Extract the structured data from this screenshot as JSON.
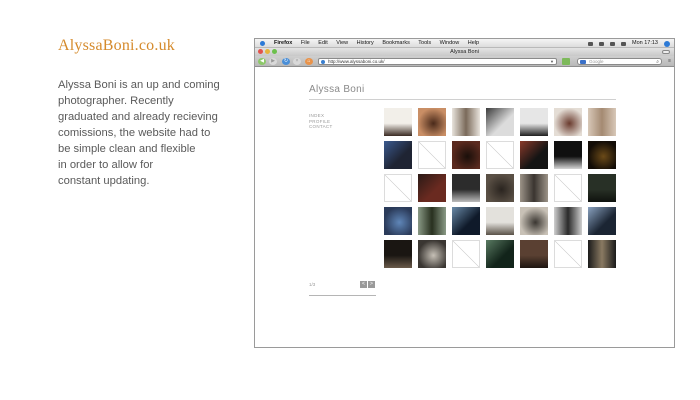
{
  "brand": "AlyssaBoni.co.uk",
  "description_lines": [
    "Alyssa Boni is an up and coming",
    "photographer. Recently",
    "graduated and already recieving",
    "comissions, the website had to",
    "be simple clean and flexible",
    "in order to allow for",
    "constant updating."
  ],
  "browser": {
    "menu": [
      "Firefox",
      "File",
      "Edit",
      "View",
      "History",
      "Bookmarks",
      "Tools",
      "Window",
      "Help"
    ],
    "clock": "Mon 17:13",
    "window_title": "Alyssa Boni",
    "url": "http://www.alyssaboni.co.uk/",
    "search_placeholder": "Google"
  },
  "site": {
    "title": "Alyssa Boni",
    "nav": [
      "INDEX",
      "PROFILE",
      "CONTACT"
    ],
    "page_counter": "1/3",
    "prev_label": "<",
    "next_label": ">"
  },
  "thumbnails": [
    {
      "c1": "#f2efe9",
      "c2": "#3a2a22"
    },
    {
      "c1": "#c98e65",
      "c2": "#4a2a1a"
    },
    {
      "c1": "#e8e3dc",
      "c2": "#7a6a5a"
    },
    {
      "c1": "#dcdcdc",
      "c2": "#3a3a3a"
    },
    {
      "c1": "#e6e6e6",
      "c2": "#1e1e1e"
    },
    {
      "c1": "#e4ddd5",
      "c2": "#6a3b2e"
    },
    {
      "c1": "#d8c8b8",
      "c2": "#a48a72"
    },
    {
      "c1": "#1f2433",
      "c2": "#3b5a8f"
    },
    {
      "empty": true
    },
    {
      "c1": "#5a2a1f",
      "c2": "#1a0f0a"
    },
    {
      "empty": true
    },
    {
      "c1": "#141414",
      "c2": "#8a3a2a"
    },
    {
      "c1": "#101010",
      "c2": "#d6d6d6"
    },
    {
      "c1": "#120c06",
      "c2": "#6b4a18"
    },
    {
      "empty": true
    },
    {
      "c1": "#6a2a20",
      "c2": "#2a1a16"
    },
    {
      "c1": "#2c2c2c",
      "c2": "#bcbcbc"
    },
    {
      "c1": "#5a5045",
      "c2": "#2a241f"
    },
    {
      "c1": "#9c9388",
      "c2": "#3a3530"
    },
    {
      "empty": true
    },
    {
      "c1": "#283026",
      "c2": "#0f120e"
    },
    {
      "c1": "#2b3b5a",
      "c2": "#5f86b8"
    },
    {
      "c1": "#8a9a86",
      "c2": "#28301f"
    },
    {
      "c1": "#0f1a2a",
      "c2": "#6a8aa8"
    },
    {
      "c1": "#e3e1dc",
      "c2": "#5a5248"
    },
    {
      "c1": "#c8c1b6",
      "c2": "#3a3631"
    },
    {
      "c1": "#cfcfcf",
      "c2": "#2a2a2a"
    },
    {
      "c1": "#1b2533",
      "c2": "#8aa2c0"
    },
    {
      "c1": "#1a1612",
      "c2": "#6a5a4a"
    },
    {
      "c1": "#3a3632",
      "c2": "#c6c0b6"
    },
    {
      "empty": true
    },
    {
      "c1": "#12241a",
      "c2": "#5a7a62"
    },
    {
      "c1": "#5a4032",
      "c2": "#1e1510"
    },
    {
      "empty": true
    },
    {
      "c1": "#1a1a1a",
      "c2": "#8a7a62"
    }
  ]
}
